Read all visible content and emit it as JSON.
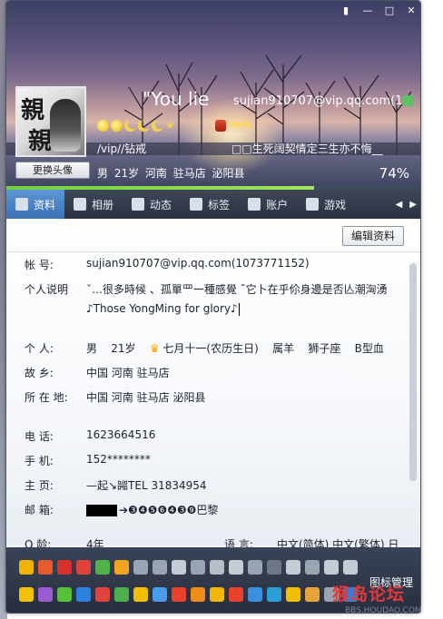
{
  "window": {
    "controls": [
      "shirt",
      "minimize",
      "maximize",
      "close"
    ]
  },
  "profile": {
    "avatar_text_1": "親",
    "avatar_text_2": "親",
    "change_avatar_label": "更换头像",
    "nickname": "\"You lie",
    "email": "sujian910707@vip.qq.com(1",
    "vip_label": "VIP8",
    "signature_left": "/vip//钻戒",
    "signature_right": "□□生死阔契情定三生亦不悔__",
    "basic_info": "男  21岁    河南 驻马店 泌阳县",
    "percent": "74%",
    "progress_value": 0.74
  },
  "tabs": [
    {
      "label": "资料",
      "icon": "profile-card-icon",
      "active": true
    },
    {
      "label": "相册",
      "icon": "photo-album-icon",
      "active": false
    },
    {
      "label": "动态",
      "icon": "feed-icon",
      "active": false
    },
    {
      "label": "标签",
      "icon": "tag-icon",
      "active": false
    },
    {
      "label": "账户",
      "icon": "wallet-icon",
      "active": false
    },
    {
      "label": "游戏",
      "icon": "game-icon",
      "active": false
    }
  ],
  "edit_button": "编辑资料",
  "fields": {
    "account": {
      "label": "帐    号:",
      "value": "sujian910707@vip.qq.com(1073771152)"
    },
    "intro": {
      "label": "个人说明",
      "value_1": "ˇ…很多時候 、孤單罒一種感覺 ˜它卜在乎伱身邊是否亾潮洶湧",
      "value_2": "♪Those YongMing for glory♪"
    },
    "personal": {
      "label": "个    人:",
      "gender": "男",
      "age": "21岁",
      "birthday": "七月十一(农历生日)",
      "zodiac": "属羊",
      "constellation": "狮子座",
      "blood": "B型血"
    },
    "hometown": {
      "label": "故    乡:",
      "value": "中国 河南 驻马店"
    },
    "location": {
      "label": "所 在 地:",
      "value": "中国 河南 驻马店 泌阳县"
    },
    "phone": {
      "label": "电    话:",
      "value": "1623664516"
    },
    "mobile": {
      "label": "手    机:",
      "value": "152********"
    },
    "homepage": {
      "label": "主    页:",
      "value": "—起↘嘂TEL  31834954"
    },
    "mail": {
      "label": "邮    箱:",
      "value": "➔❸❹❺❻❹❸❾巴黎"
    },
    "q_age": {
      "label": "Q    龄:",
      "value": "4年"
    },
    "language": {
      "label": "语    言:",
      "value": "中文(简体)   中文(繁体)  日"
    }
  },
  "icon_manager": "图标管理",
  "watermark": {
    "main": "猴岛论坛",
    "sub": "BBS.HOUDAO.COM"
  },
  "colors": {
    "accent_tab": "#3a72b5",
    "progress": "#7fd94a",
    "iconbar": "#2f3647"
  }
}
